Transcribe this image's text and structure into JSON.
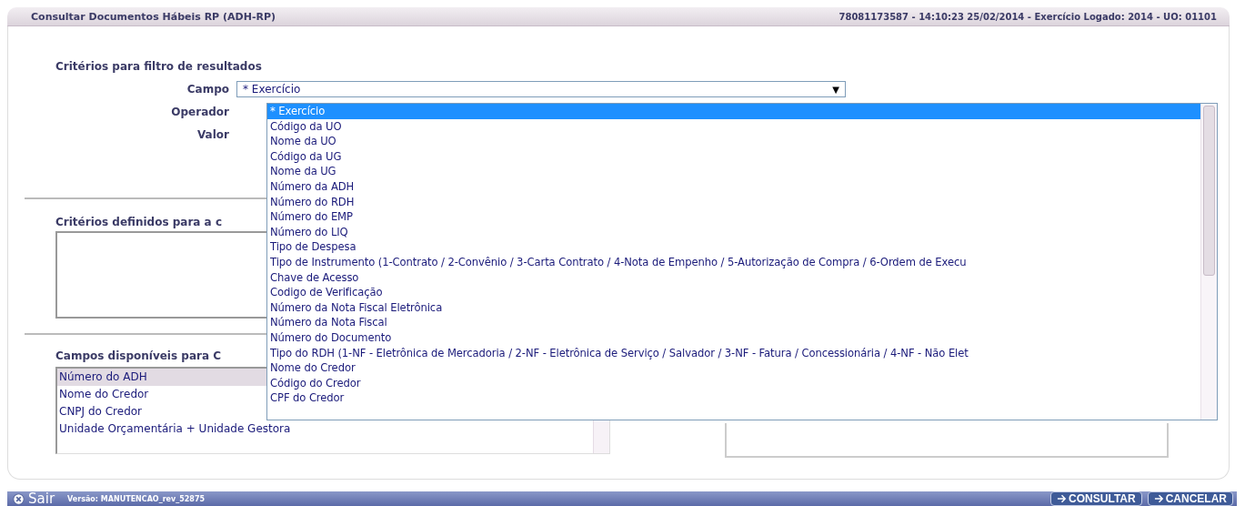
{
  "window": {
    "title": "Consultar Documentos Hábeis RP (ADH-RP)",
    "session_info": "78081173587 - 14:10:23 25/02/2014 - Exercício Logado: 2014 - UO: 01101"
  },
  "filter": {
    "heading": "Critérios para filtro de resultados",
    "labels": [
      "Campo",
      "Operador",
      "Valor"
    ],
    "campo_value": "* Exercício",
    "campo_arrow": "▼"
  },
  "dropdown": {
    "options": [
      {
        "label": "* Exercício",
        "selected": true
      },
      {
        "label": "Código da UO",
        "selected": false
      },
      {
        "label": "Nome da UO",
        "selected": false
      },
      {
        "label": "Código da UG",
        "selected": false
      },
      {
        "label": "Nome da UG",
        "selected": false
      },
      {
        "label": "Número da ADH",
        "selected": false
      },
      {
        "label": "Número do RDH",
        "selected": false
      },
      {
        "label": "Número do EMP",
        "selected": false
      },
      {
        "label": "Número do LIQ",
        "selected": false
      },
      {
        "label": "Tipo de Despesa",
        "selected": false
      },
      {
        "label": "Tipo de Instrumento (1-Contrato / 2-Convênio / 3-Carta Contrato / 4-Nota de Empenho / 5-Autorização de Compra / 6-Ordem de Execu",
        "selected": false
      },
      {
        "label": "Chave de Acesso",
        "selected": false
      },
      {
        "label": "Codigo de Verificação",
        "selected": false
      },
      {
        "label": "Número da Nota Fiscal Eletrônica",
        "selected": false
      },
      {
        "label": "Número da Nota Fiscal",
        "selected": false
      },
      {
        "label": "Número do Documento",
        "selected": false
      },
      {
        "label": "Tipo do RDH (1-NF - Eletrônica de Mercadoria / 2-NF - Eletrônica de Serviço / Salvador / 3-NF - Fatura / Concessionária / 4-NF - Não Elet",
        "selected": false
      },
      {
        "label": "Nome do Credor",
        "selected": false
      },
      {
        "label": "Código do Credor",
        "selected": false
      },
      {
        "label": "CPF do Credor",
        "selected": false
      }
    ]
  },
  "criteria": {
    "heading": "Critérios definidos para a c"
  },
  "available_fields": {
    "heading": "Campos disponíveis para C",
    "items": [
      {
        "label": "Número do ADH",
        "selected": true
      },
      {
        "label": "Nome do Credor",
        "selected": false
      },
      {
        "label": "CNPJ do Credor",
        "selected": false
      },
      {
        "label": "Unidade Orçamentária + Unidade Gestora",
        "selected": false
      }
    ]
  },
  "footer": {
    "exit": "Sair",
    "version": "Versão: MANUTENCAO_rev_52875",
    "buttons": [
      "CONSULTAR",
      "CANCELAR"
    ]
  }
}
